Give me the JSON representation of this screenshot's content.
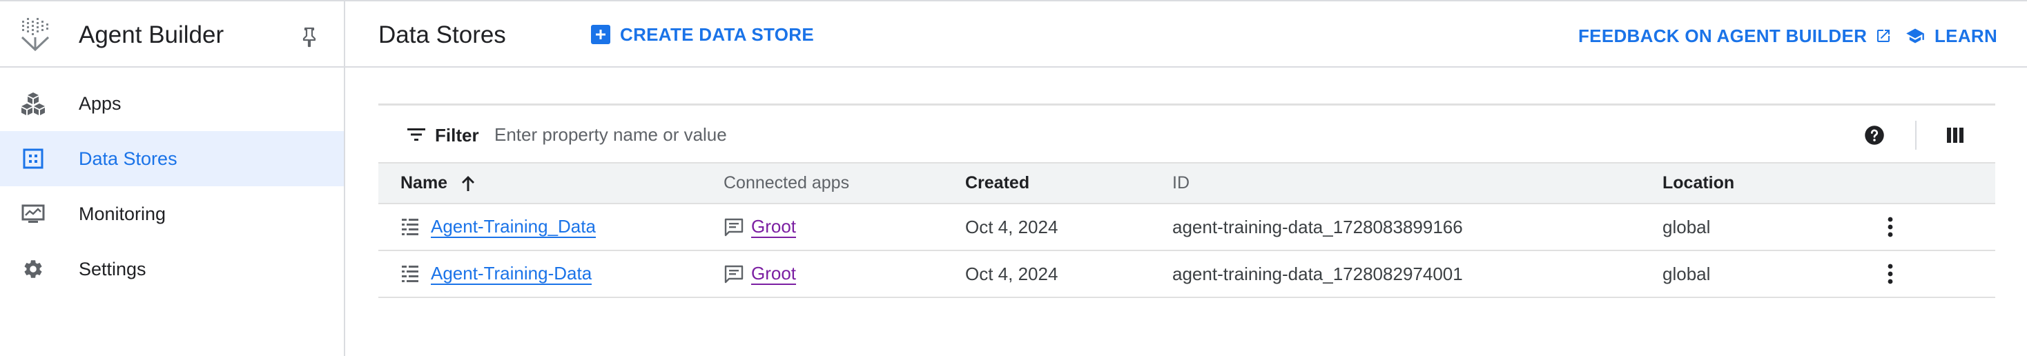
{
  "sidebar": {
    "title": "Agent Builder",
    "items": [
      {
        "label": "Apps",
        "icon": "apps-cubes-icon",
        "active": false
      },
      {
        "label": "Data Stores",
        "icon": "data-stores-icon",
        "active": true
      },
      {
        "label": "Monitoring",
        "icon": "monitoring-icon",
        "active": false
      },
      {
        "label": "Settings",
        "icon": "gear-icon",
        "active": false
      }
    ]
  },
  "header": {
    "title": "Data Stores",
    "create_label": "CREATE DATA STORE",
    "feedback_label": "FEEDBACK ON AGENT BUILDER",
    "learn_label": "LEARN"
  },
  "filter": {
    "label": "Filter",
    "placeholder": "Enter property name or value",
    "value": ""
  },
  "table": {
    "columns": [
      "Name",
      "Connected apps",
      "Created",
      "ID",
      "Location"
    ],
    "sort_column": "Name",
    "sort_direction": "ascending",
    "rows": [
      {
        "name": "Agent-Training_Data",
        "connected_app": "Groot",
        "created": "Oct 4, 2024",
        "id": "agent-training-data_1728083899166",
        "location": "global"
      },
      {
        "name": "Agent-Training-Data",
        "connected_app": "Groot",
        "created": "Oct 4, 2024",
        "id": "agent-training-data_1728082974001",
        "location": "global"
      }
    ]
  },
  "colors": {
    "accent": "#1a73e8",
    "active_nav_bg": "#e8f0fe",
    "app_link": "#7b1fa2",
    "icon_gray": "#5f6368"
  }
}
